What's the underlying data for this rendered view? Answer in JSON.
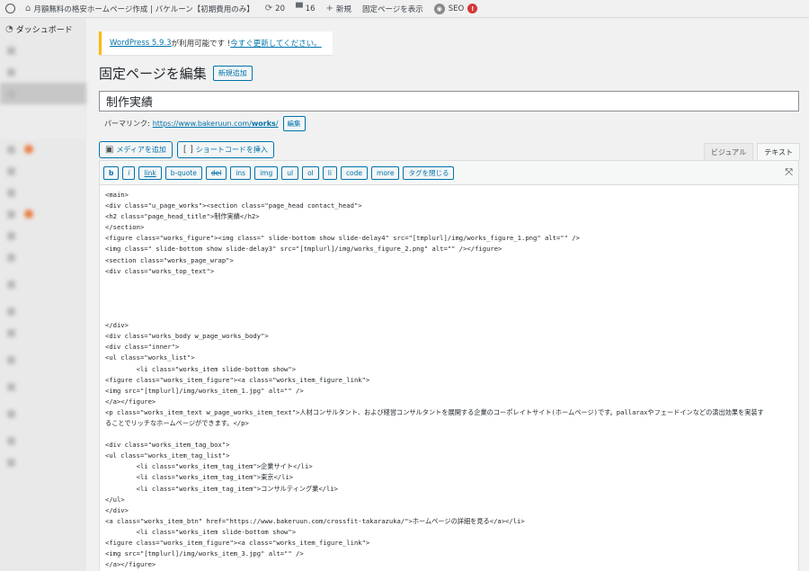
{
  "adminbar": {
    "site_title": "月額無料の格安ホームページ作成 | バケルーン【初期費用のみ】",
    "updates_count": "20",
    "comments_count": "16",
    "new_label": "新規",
    "view_page_label": "固定ページを表示",
    "seo_label": "SEO",
    "seo_badge": "!"
  },
  "sidebar": {
    "dashboard_label": "ダッシュボード"
  },
  "notice": {
    "version_link": "WordPress 5.9.3",
    "text": " が利用可能です ! ",
    "update_link": "今すぐ更新してください。"
  },
  "page": {
    "heading": "固定ページを編集",
    "add_new_label": "新規追加",
    "title_value": "制作実績",
    "permalink_label": "パーマリンク:",
    "permalink_base": "https://www.bakeruun.com/",
    "permalink_slug": "works",
    "permalink_trailing": "/",
    "edit_label": "編集"
  },
  "editor": {
    "add_media_label": "メディアを追加",
    "shortcode_label": "ショートコードを挿入",
    "tab_visual": "ビジュアル",
    "tab_text": "テキスト",
    "quicktags": [
      "b",
      "i",
      "link",
      "b-quote",
      "del",
      "ins",
      "img",
      "ul",
      "ol",
      "li",
      "code",
      "more",
      "タグを閉じる"
    ],
    "content": "<main>\n<div class=\"u_page_works\"><section class=\"page_head contact_head\">\n<h2 class=\"page_head_title\">制作実績</h2>\n</section>\n<figure class=\"works_figure\"><img class=\" slide-bottom show slide-delay4\" src=\"[tmplurl]/img/works_figure_1.png\" alt=\"\" />\n<img class=\" slide-bottom show slide-delay3\" src=\"[tmplurl]/img/works_figure_2.png\" alt=\"\" /></figure>\n<section class=\"works_page_wrap\">\n<div class=\"works_top_text\">\n\n\n\n\n</div>\n<div class=\"works_body w_page_works_body\">\n<div class=\"inner\">\n<ul class=\"works_list\">\n        <li class=\"works_item slide-bottom show\">\n<figure class=\"works_item_figure\"><a class=\"works_item_figure_link\">\n<img src=\"[tmplurl]/img/works_item_1.jpg\" alt=\"\" />\n</a></figure>\n<p class=\"works_item_text w_page_works_item_text\">人材コンサルタント、および経営コンサルタントを展開する企業のコーポレイトサイト(ホームページ)です。pallaraxやフェードインなどの演出効果を実装す\nることでリッチなホームページができます。</p>\n\n<div class=\"works_item_tag_box\">\n<ul class=\"works_item_tag_list\">\n        <li class=\"works_item_tag_item\">企業サイト</li>\n        <li class=\"works_item_tag_item\">東京</li>\n        <li class=\"works_item_tag_item\">コンサルティング業</li>\n</ul>\n</div>\n<a class=\"works_item_btn\" href=\"https://www.bakeruun.com/crossfit-takarazuka/\">ホームページの詳細を見る</a></li>\n        <li class=\"works_item slide-bottom show\">\n<figure class=\"works_item_figure\"><a class=\"works_item_figure_link\">\n<img src=\"[tmplurl]/img/works_item_3.jpg\" alt=\"\" />\n</a></figure>\n<p class=\"works_item_text w_page_works_item_text\">システムやコンサルティング、システムインテグレーション、クラウドサービスなどのサービスを提供する企業のホームページです。</p>"
  }
}
